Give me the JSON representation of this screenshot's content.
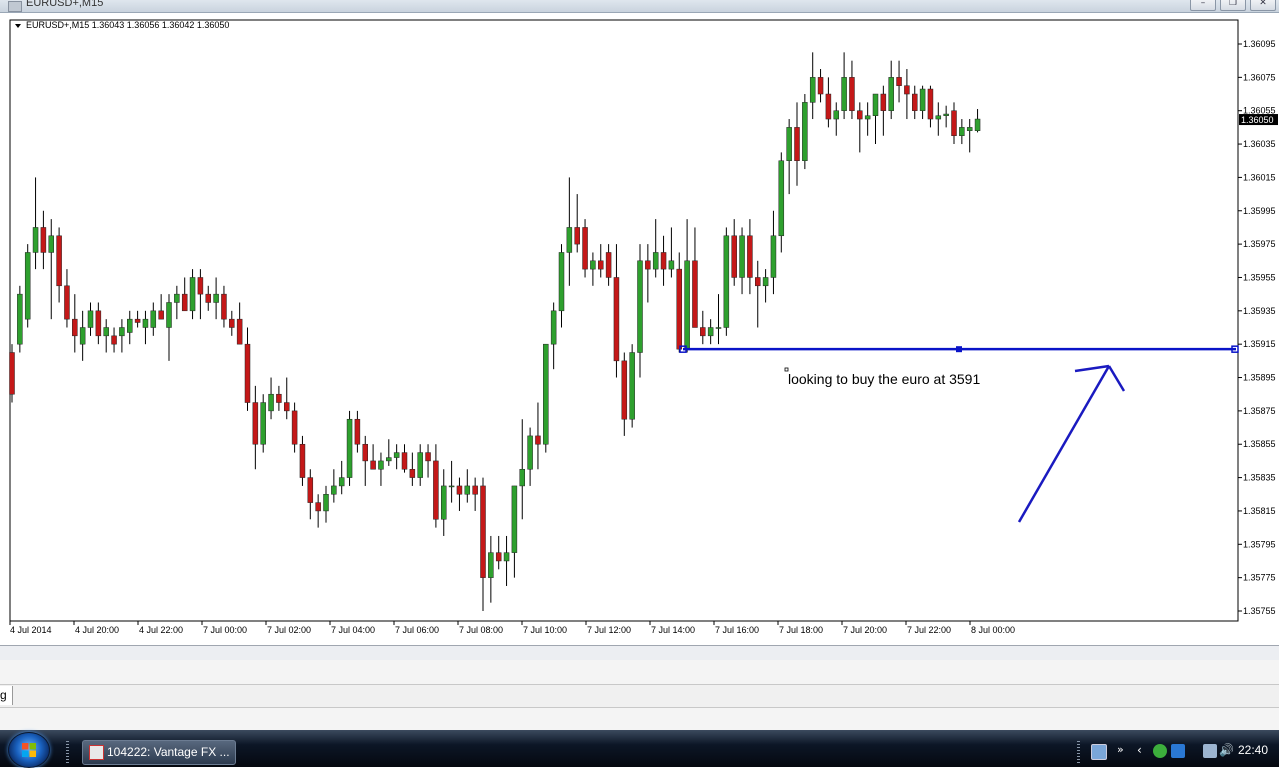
{
  "window": {
    "title": "EURUSD+,M15",
    "buttons": [
      "minimize",
      "restore",
      "close"
    ]
  },
  "chart": {
    "header": "EURUSD+,M15  1.36043 1.36056 1.36042 1.36050",
    "symbol": "EURUSD+",
    "timeframe": "M15",
    "ohlc": {
      "open": 1.36043,
      "high": 1.36056,
      "low": 1.36042,
      "close": 1.3605
    },
    "current_price_label": "1.36050",
    "price_ticks": [
      "1.36095",
      "1.36075",
      "1.36055",
      "1.36035",
      "1.36015",
      "1.35995",
      "1.35975",
      "1.35955",
      "1.35935",
      "1.35915",
      "1.35895",
      "1.35875",
      "1.35855",
      "1.35835",
      "1.35815",
      "1.35795",
      "1.35775",
      "1.35755"
    ],
    "time_ticks": [
      "4 Jul 2014",
      "4 Jul 20:00",
      "4 Jul 22:00",
      "7 Jul 00:00",
      "7 Jul 02:00",
      "7 Jul 04:00",
      "7 Jul 06:00",
      "7 Jul 08:00",
      "7 Jul 10:00",
      "7 Jul 12:00",
      "7 Jul 14:00",
      "7 Jul 16:00",
      "7 Jul 18:00",
      "7 Jul 20:00",
      "7 Jul 22:00",
      "8 Jul 00:00"
    ],
    "annotation_text": "looking to buy the euro at 3591",
    "horizontal_level": 1.35912,
    "colors": {
      "bull": "#2ea02e",
      "bear": "#c41818",
      "wick": "#000000",
      "line": "#0a14c8",
      "arrow": "#1a1ac0",
      "grid_bg": "#ffffff",
      "price_label_bg": "#000000"
    }
  },
  "terminal": {
    "tab_label": "g"
  },
  "taskbar": {
    "task_label": "104222: Vantage FX ...",
    "clock": "22:40",
    "tray_icons": [
      "monitor-icon",
      "show-more-icon",
      "chevron-left-icon",
      "shield-icon",
      "network-icon",
      "printer-icon",
      "volume-icon"
    ]
  },
  "chart_data": {
    "type": "candlestick",
    "title": "EURUSD+,M15",
    "xlabel": "",
    "ylabel": "",
    "ylim": [
      1.35745,
      1.36105
    ],
    "candles": [
      {
        "o": 1.3591,
        "h": 1.35915,
        "l": 1.3588,
        "c": 1.35885
      },
      {
        "o": 1.35915,
        "h": 1.3595,
        "l": 1.3591,
        "c": 1.35945
      },
      {
        "o": 1.3593,
        "h": 1.35975,
        "l": 1.35925,
        "c": 1.3597
      },
      {
        "o": 1.3597,
        "h": 1.36015,
        "l": 1.3596,
        "c": 1.35985
      },
      {
        "o": 1.35985,
        "h": 1.35995,
        "l": 1.3596,
        "c": 1.3597
      },
      {
        "o": 1.3597,
        "h": 1.3599,
        "l": 1.3593,
        "c": 1.3598
      },
      {
        "o": 1.3598,
        "h": 1.35985,
        "l": 1.3594,
        "c": 1.3595
      },
      {
        "o": 1.3595,
        "h": 1.3596,
        "l": 1.35925,
        "c": 1.3593
      },
      {
        "o": 1.3593,
        "h": 1.35945,
        "l": 1.3591,
        "c": 1.3592
      },
      {
        "o": 1.35915,
        "h": 1.35935,
        "l": 1.35905,
        "c": 1.35925
      },
      {
        "o": 1.35925,
        "h": 1.3594,
        "l": 1.3592,
        "c": 1.35935
      },
      {
        "o": 1.35935,
        "h": 1.3594,
        "l": 1.35915,
        "c": 1.3592
      },
      {
        "o": 1.3592,
        "h": 1.3593,
        "l": 1.3591,
        "c": 1.35925
      },
      {
        "o": 1.3592,
        "h": 1.35925,
        "l": 1.3591,
        "c": 1.35915
      },
      {
        "o": 1.3592,
        "h": 1.3593,
        "l": 1.3591,
        "c": 1.35925
      },
      {
        "o": 1.35922,
        "h": 1.35935,
        "l": 1.35915,
        "c": 1.3593
      },
      {
        "o": 1.3593,
        "h": 1.35935,
        "l": 1.35925,
        "c": 1.35928
      },
      {
        "o": 1.35925,
        "h": 1.35935,
        "l": 1.35915,
        "c": 1.3593
      },
      {
        "o": 1.35925,
        "h": 1.3594,
        "l": 1.3592,
        "c": 1.35935
      },
      {
        "o": 1.35935,
        "h": 1.35945,
        "l": 1.3593,
        "c": 1.3593
      },
      {
        "o": 1.35925,
        "h": 1.35945,
        "l": 1.35905,
        "c": 1.3594
      },
      {
        "o": 1.3594,
        "h": 1.3595,
        "l": 1.3593,
        "c": 1.35945
      },
      {
        "o": 1.35945,
        "h": 1.35955,
        "l": 1.35935,
        "c": 1.35935
      },
      {
        "o": 1.35935,
        "h": 1.3596,
        "l": 1.3593,
        "c": 1.35955
      },
      {
        "o": 1.35955,
        "h": 1.3596,
        "l": 1.3593,
        "c": 1.35945
      },
      {
        "o": 1.35945,
        "h": 1.3595,
        "l": 1.35935,
        "c": 1.3594
      },
      {
        "o": 1.3594,
        "h": 1.35955,
        "l": 1.3593,
        "c": 1.35945
      },
      {
        "o": 1.35945,
        "h": 1.3595,
        "l": 1.35925,
        "c": 1.3593
      },
      {
        "o": 1.3593,
        "h": 1.35935,
        "l": 1.3592,
        "c": 1.35925
      },
      {
        "o": 1.3593,
        "h": 1.3594,
        "l": 1.35915,
        "c": 1.35915
      },
      {
        "o": 1.35915,
        "h": 1.35925,
        "l": 1.35875,
        "c": 1.3588
      },
      {
        "o": 1.3588,
        "h": 1.3589,
        "l": 1.3584,
        "c": 1.35855
      },
      {
        "o": 1.35855,
        "h": 1.35885,
        "l": 1.3585,
        "c": 1.3588
      },
      {
        "o": 1.35875,
        "h": 1.35895,
        "l": 1.3587,
        "c": 1.35885
      },
      {
        "o": 1.35885,
        "h": 1.3589,
        "l": 1.35875,
        "c": 1.3588
      },
      {
        "o": 1.3588,
        "h": 1.35895,
        "l": 1.3587,
        "c": 1.35875
      },
      {
        "o": 1.35875,
        "h": 1.3588,
        "l": 1.3585,
        "c": 1.35855
      },
      {
        "o": 1.35855,
        "h": 1.3586,
        "l": 1.3583,
        "c": 1.35835
      },
      {
        "o": 1.35835,
        "h": 1.3584,
        "l": 1.3581,
        "c": 1.3582
      },
      {
        "o": 1.3582,
        "h": 1.35825,
        "l": 1.35805,
        "c": 1.35815
      },
      {
        "o": 1.35815,
        "h": 1.3583,
        "l": 1.35808,
        "c": 1.35825
      },
      {
        "o": 1.35825,
        "h": 1.3584,
        "l": 1.3582,
        "c": 1.3583
      },
      {
        "o": 1.3583,
        "h": 1.35845,
        "l": 1.35825,
        "c": 1.35835
      },
      {
        "o": 1.35835,
        "h": 1.35875,
        "l": 1.3583,
        "c": 1.3587
      },
      {
        "o": 1.3587,
        "h": 1.35875,
        "l": 1.3585,
        "c": 1.35855
      },
      {
        "o": 1.35855,
        "h": 1.3586,
        "l": 1.3583,
        "c": 1.35845
      },
      {
        "o": 1.35845,
        "h": 1.35855,
        "l": 1.3584,
        "c": 1.3584
      },
      {
        "o": 1.3584,
        "h": 1.3585,
        "l": 1.3583,
        "c": 1.35845
      },
      {
        "o": 1.35845,
        "h": 1.35858,
        "l": 1.35842,
        "c": 1.35847
      },
      {
        "o": 1.35847,
        "h": 1.35855,
        "l": 1.3584,
        "c": 1.3585
      },
      {
        "o": 1.3585,
        "h": 1.35855,
        "l": 1.35838,
        "c": 1.3584
      },
      {
        "o": 1.3584,
        "h": 1.3585,
        "l": 1.3583,
        "c": 1.35835
      },
      {
        "o": 1.35835,
        "h": 1.35855,
        "l": 1.3583,
        "c": 1.3585
      },
      {
        "o": 1.3585,
        "h": 1.35855,
        "l": 1.35835,
        "c": 1.35845
      },
      {
        "o": 1.35845,
        "h": 1.35855,
        "l": 1.35805,
        "c": 1.3581
      },
      {
        "o": 1.3581,
        "h": 1.3584,
        "l": 1.358,
        "c": 1.3583
      },
      {
        "o": 1.3583,
        "h": 1.35845,
        "l": 1.3582,
        "c": 1.3583
      },
      {
        "o": 1.3583,
        "h": 1.35835,
        "l": 1.35815,
        "c": 1.35825
      },
      {
        "o": 1.35825,
        "h": 1.3584,
        "l": 1.3582,
        "c": 1.3583
      },
      {
        "o": 1.3583,
        "h": 1.35835,
        "l": 1.35815,
        "c": 1.35825
      },
      {
        "o": 1.3583,
        "h": 1.35835,
        "l": 1.35755,
        "c": 1.35775
      },
      {
        "o": 1.35775,
        "h": 1.358,
        "l": 1.3576,
        "c": 1.3579
      },
      {
        "o": 1.3579,
        "h": 1.358,
        "l": 1.3578,
        "c": 1.35785
      },
      {
        "o": 1.35785,
        "h": 1.358,
        "l": 1.3577,
        "c": 1.3579
      },
      {
        "o": 1.3579,
        "h": 1.3583,
        "l": 1.35775,
        "c": 1.3583
      },
      {
        "o": 1.3583,
        "h": 1.3587,
        "l": 1.3581,
        "c": 1.3584
      },
      {
        "o": 1.3584,
        "h": 1.35865,
        "l": 1.3583,
        "c": 1.3586
      },
      {
        "o": 1.3586,
        "h": 1.3588,
        "l": 1.3584,
        "c": 1.35855
      },
      {
        "o": 1.35855,
        "h": 1.35915,
        "l": 1.3585,
        "c": 1.35915
      },
      {
        "o": 1.35915,
        "h": 1.3594,
        "l": 1.359,
        "c": 1.35935
      },
      {
        "o": 1.35935,
        "h": 1.35975,
        "l": 1.35925,
        "c": 1.3597
      },
      {
        "o": 1.3597,
        "h": 1.36015,
        "l": 1.3595,
        "c": 1.35985
      },
      {
        "o": 1.35985,
        "h": 1.36005,
        "l": 1.3597,
        "c": 1.35975
      },
      {
        "o": 1.35985,
        "h": 1.3599,
        "l": 1.35955,
        "c": 1.3596
      },
      {
        "o": 1.3596,
        "h": 1.3597,
        "l": 1.3595,
        "c": 1.35965
      },
      {
        "o": 1.35965,
        "h": 1.35975,
        "l": 1.35955,
        "c": 1.3596
      },
      {
        "o": 1.3597,
        "h": 1.35975,
        "l": 1.3595,
        "c": 1.35955
      },
      {
        "o": 1.35955,
        "h": 1.35975,
        "l": 1.35895,
        "c": 1.35905
      },
      {
        "o": 1.35905,
        "h": 1.3591,
        "l": 1.3586,
        "c": 1.3587
      },
      {
        "o": 1.3587,
        "h": 1.35915,
        "l": 1.35865,
        "c": 1.3591
      },
      {
        "o": 1.3591,
        "h": 1.35975,
        "l": 1.35895,
        "c": 1.35965
      },
      {
        "o": 1.35965,
        "h": 1.35975,
        "l": 1.3594,
        "c": 1.3596
      },
      {
        "o": 1.3596,
        "h": 1.3599,
        "l": 1.35955,
        "c": 1.3597
      },
      {
        "o": 1.3597,
        "h": 1.3598,
        "l": 1.3595,
        "c": 1.3596
      },
      {
        "o": 1.3596,
        "h": 1.35985,
        "l": 1.35955,
        "c": 1.35965
      },
      {
        "o": 1.3596,
        "h": 1.3597,
        "l": 1.3591,
        "c": 1.35912
      },
      {
        "o": 1.35912,
        "h": 1.3599,
        "l": 1.3591,
        "c": 1.35965
      },
      {
        "o": 1.35965,
        "h": 1.35985,
        "l": 1.35925,
        "c": 1.35925
      },
      {
        "o": 1.35925,
        "h": 1.35935,
        "l": 1.35915,
        "c": 1.3592
      },
      {
        "o": 1.3592,
        "h": 1.3593,
        "l": 1.35915,
        "c": 1.35925
      },
      {
        "o": 1.35925,
        "h": 1.35945,
        "l": 1.35915,
        "c": 1.35925
      },
      {
        "o": 1.35925,
        "h": 1.35985,
        "l": 1.3592,
        "c": 1.3598
      },
      {
        "o": 1.3598,
        "h": 1.3599,
        "l": 1.3595,
        "c": 1.35955
      },
      {
        "o": 1.35955,
        "h": 1.35985,
        "l": 1.35945,
        "c": 1.3598
      },
      {
        "o": 1.3598,
        "h": 1.3599,
        "l": 1.35945,
        "c": 1.35955
      },
      {
        "o": 1.35955,
        "h": 1.35965,
        "l": 1.35925,
        "c": 1.3595
      },
      {
        "o": 1.3595,
        "h": 1.3596,
        "l": 1.3594,
        "c": 1.35955
      },
      {
        "o": 1.35955,
        "h": 1.35995,
        "l": 1.35945,
        "c": 1.3598
      },
      {
        "o": 1.3598,
        "h": 1.3603,
        "l": 1.3597,
        "c": 1.36025
      },
      {
        "o": 1.36025,
        "h": 1.3605,
        "l": 1.36005,
        "c": 1.36045
      },
      {
        "o": 1.36045,
        "h": 1.3606,
        "l": 1.3601,
        "c": 1.36025
      },
      {
        "o": 1.36025,
        "h": 1.36065,
        "l": 1.3602,
        "c": 1.3606
      },
      {
        "o": 1.3606,
        "h": 1.3609,
        "l": 1.3605,
        "c": 1.36075
      },
      {
        "o": 1.36075,
        "h": 1.3608,
        "l": 1.3606,
        "c": 1.36065
      },
      {
        "o": 1.36065,
        "h": 1.36075,
        "l": 1.36045,
        "c": 1.3605
      },
      {
        "o": 1.3605,
        "h": 1.3606,
        "l": 1.3604,
        "c": 1.36055
      },
      {
        "o": 1.36055,
        "h": 1.3609,
        "l": 1.3605,
        "c": 1.36075
      },
      {
        "o": 1.36075,
        "h": 1.36085,
        "l": 1.3605,
        "c": 1.36055
      },
      {
        "o": 1.36055,
        "h": 1.3606,
        "l": 1.3603,
        "c": 1.3605
      },
      {
        "o": 1.3605,
        "h": 1.3606,
        "l": 1.3604,
        "c": 1.36052
      },
      {
        "o": 1.36052,
        "h": 1.36065,
        "l": 1.36035,
        "c": 1.36065
      },
      {
        "o": 1.36065,
        "h": 1.3607,
        "l": 1.3604,
        "c": 1.36055
      },
      {
        "o": 1.36055,
        "h": 1.36085,
        "l": 1.3605,
        "c": 1.36075
      },
      {
        "o": 1.36075,
        "h": 1.36085,
        "l": 1.3606,
        "c": 1.3607
      },
      {
        "o": 1.3607,
        "h": 1.3608,
        "l": 1.3605,
        "c": 1.36065
      },
      {
        "o": 1.36065,
        "h": 1.3607,
        "l": 1.3605,
        "c": 1.36055
      },
      {
        "o": 1.36055,
        "h": 1.3607,
        "l": 1.3605,
        "c": 1.36068
      },
      {
        "o": 1.36068,
        "h": 1.3607,
        "l": 1.36045,
        "c": 1.3605
      },
      {
        "o": 1.3605,
        "h": 1.3606,
        "l": 1.3604,
        "c": 1.36052
      },
      {
        "o": 1.36052,
        "h": 1.36058,
        "l": 1.36045,
        "c": 1.36053
      },
      {
        "o": 1.36055,
        "h": 1.3606,
        "l": 1.36035,
        "c": 1.3604
      },
      {
        "o": 1.3604,
        "h": 1.3605,
        "l": 1.36035,
        "c": 1.36045
      },
      {
        "o": 1.36043,
        "h": 1.3605,
        "l": 1.3603,
        "c": 1.36045
      },
      {
        "o": 1.36043,
        "h": 1.36056,
        "l": 1.36042,
        "c": 1.3605
      }
    ]
  }
}
